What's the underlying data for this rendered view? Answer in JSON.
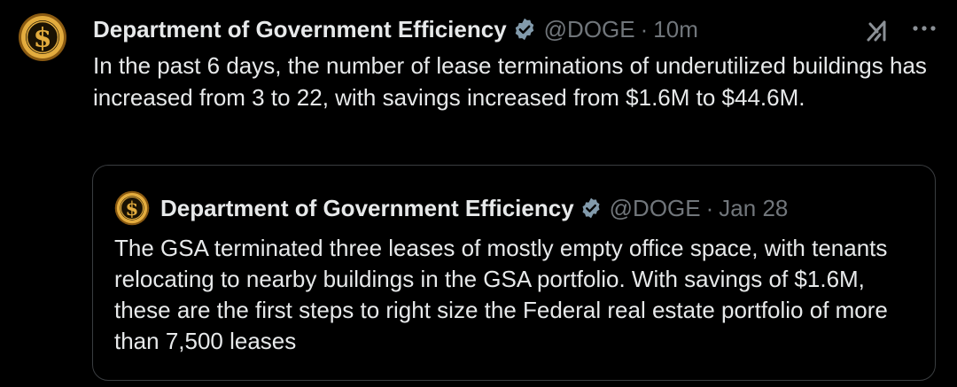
{
  "tweet": {
    "author_name": "Department of Government Efficiency",
    "handle": "@DOGE",
    "separator": "·",
    "time": "10m",
    "text": "In the past 6 days, the number of lease terminations of underutilized buildings has increased from 3 to 22, with savings increased from $1.6M to $44.6M.",
    "avatar_icon": "dollar-coin-icon",
    "badge_icon": "verified-badge-icon"
  },
  "toolbar": {
    "grok_icon": "grok-icon",
    "more_icon": "more-options-icon"
  },
  "quoted_tweet": {
    "author_name": "Department of Government Efficiency",
    "handle": "@DOGE",
    "separator": "·",
    "time": "Jan 28",
    "text": "The GSA terminated three leases of mostly empty office space, with tenants relocating to nearby buildings in the GSA portfolio.  With savings of $1.6M, these are the first steps to right size the Federal real estate portfolio of more than 7,500 leases"
  },
  "colors": {
    "background": "#000000",
    "primary_text": "#e7e9ea",
    "secondary_text": "#71767b",
    "verified_badge": "#829aab",
    "quote_border": "#3a3d40",
    "coin_gold": "#d9a23a"
  }
}
